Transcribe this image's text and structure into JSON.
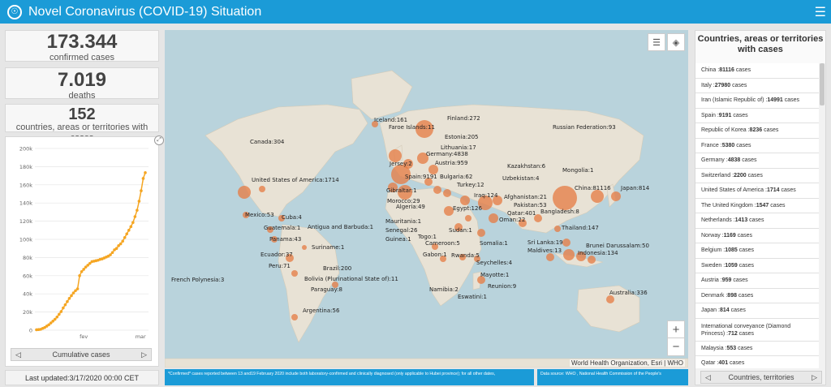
{
  "header": {
    "title": "Novel Coronavirus (COVID-19) Situation",
    "menu_icon": "hamburger-icon"
  },
  "stats": {
    "confirmed": {
      "value": "173.344",
      "label": "confirmed cases"
    },
    "deaths": {
      "value": "7.019",
      "label": "deaths"
    },
    "countries": {
      "value": "152",
      "label": "countries, areas or territories with cases"
    }
  },
  "chart_data": {
    "type": "area",
    "title": "",
    "xlabel": "",
    "ylabel": "",
    "x_ticks": [
      "fev",
      "mar"
    ],
    "y_ticks": [
      "0",
      "20k",
      "40k",
      "60k",
      "80k",
      "100k",
      "120k",
      "140k",
      "160k",
      "180k",
      "200k"
    ],
    "ylim": [
      0,
      200000
    ],
    "grid": true,
    "series": [
      {
        "values": [
          500,
          700,
          1000,
          2000,
          3000,
          4500,
          6000,
          8000,
          10000,
          12000,
          14500,
          17500,
          20500,
          24500,
          28000,
          31500,
          35000,
          38000,
          41000,
          43500,
          45500,
          60000,
          64500,
          67000,
          69500,
          71500,
          73500,
          75500,
          76000,
          76500,
          77000,
          78000,
          78500,
          79500,
          80500,
          81500,
          83000,
          85500,
          88500,
          90000,
          93000,
          95000,
          98000,
          102000,
          106000,
          110000,
          114000,
          118500,
          125000,
          132000,
          142000,
          153500,
          167000,
          173344
        ]
      }
    ],
    "nav_label": "Cumulative cases"
  },
  "updated": "Last updated:3/17/2020 00:00 CET",
  "map": {
    "labels": [
      {
        "t": "Iceland:161"
      },
      {
        "t": "Finland:272"
      },
      {
        "t": "Faroe Islands:11"
      },
      {
        "t": "Estonia:205"
      },
      {
        "t": "Russian Federation:93"
      },
      {
        "t": "Canada:304"
      },
      {
        "t": "Lithuania:17"
      },
      {
        "t": "Germany:4838"
      },
      {
        "t": "Jersey:2"
      },
      {
        "t": "Austria:959"
      },
      {
        "t": "Kazakhstan:6"
      },
      {
        "t": "Mongolia:1"
      },
      {
        "t": "United States of America:1714"
      },
      {
        "t": "Spain:9191"
      },
      {
        "t": "Bulgaria:62"
      },
      {
        "t": "Uzbekistan:4"
      },
      {
        "t": "Turkey:12"
      },
      {
        "t": "China:81116"
      },
      {
        "t": "Japan:814"
      },
      {
        "t": "Gibraltar:1"
      },
      {
        "t": "Iraq:124"
      },
      {
        "t": "Afghanistan:21"
      },
      {
        "t": "Morocco:29"
      },
      {
        "t": "Pakistan:53"
      },
      {
        "t": "Algeria:49"
      },
      {
        "t": "Egypt:126"
      },
      {
        "t": "Qatar:401"
      },
      {
        "t": "Bangladesh:8"
      },
      {
        "t": "Mexico:53"
      },
      {
        "t": "Cuba:4"
      },
      {
        "t": "Oman:22"
      },
      {
        "t": "Mauritania:1"
      },
      {
        "t": "Thailand:147"
      },
      {
        "t": "Guatemala:1"
      },
      {
        "t": "Antigua and Barbuda:1"
      },
      {
        "t": "Senegal:26"
      },
      {
        "t": "Sudan:1"
      },
      {
        "t": "Panama:43"
      },
      {
        "t": "Togo:1"
      },
      {
        "t": "Guinea:1"
      },
      {
        "t": "Suriname:1"
      },
      {
        "t": "Cameroon:5"
      },
      {
        "t": "Somalia:1"
      },
      {
        "t": "Sri Lanka:19"
      },
      {
        "t": "Maldives:13"
      },
      {
        "t": "Brunei Darussalam:50"
      },
      {
        "t": "Ecuador:37"
      },
      {
        "t": "Gabon:1"
      },
      {
        "t": "Rwanda:5"
      },
      {
        "t": "Indonesia:134"
      },
      {
        "t": "Peru:71"
      },
      {
        "t": "Brazil:200"
      },
      {
        "t": "Seychelles:4"
      },
      {
        "t": "Mayotte:1"
      },
      {
        "t": "French Polynesia:3"
      },
      {
        "t": "Bolivia (Plurinational State of):11"
      },
      {
        "t": "Namibia:2"
      },
      {
        "t": "Reunion:9"
      },
      {
        "t": "Paraguay:8"
      },
      {
        "t": "Eswatini:1"
      },
      {
        "t": "Australia:336"
      },
      {
        "t": "Argentina:56"
      }
    ],
    "attribution": "World Health Organization, Esri | WHO",
    "zoom_in": "+",
    "zoom_out": "−",
    "footnote": "*Confirmed* cases reported between 13 and19 February 2020 include both laboratory-confirmed and clinically diagnosed (only  applicable to Hubei province); for all other dates,",
    "source": "Data source: WHO , National Health Commission of the People's"
  },
  "right_panel": {
    "title": "Countries, areas or territories with cases",
    "suffix": "cases",
    "items": [
      {
        "name": "China",
        "count": "81116"
      },
      {
        "name": "Italy",
        "count": "27980"
      },
      {
        "name": "Iran (Islamic Republic of)",
        "count": "14991"
      },
      {
        "name": "Spain",
        "count": "9191"
      },
      {
        "name": "Republic of Korea",
        "count": "8236"
      },
      {
        "name": "France",
        "count": "5380"
      },
      {
        "name": "Germany",
        "count": "4838"
      },
      {
        "name": "Switzerland",
        "count": "2200"
      },
      {
        "name": "United States of America",
        "count": "1714"
      },
      {
        "name": "The United Kingdom",
        "count": "1547"
      },
      {
        "name": "Netherlands",
        "count": "1413"
      },
      {
        "name": "Norway",
        "count": "1169"
      },
      {
        "name": "Belgium",
        "count": "1085"
      },
      {
        "name": "Sweden",
        "count": "1059"
      },
      {
        "name": "Austria",
        "count": "959"
      },
      {
        "name": "Denmark",
        "count": "898"
      },
      {
        "name": "Japan",
        "count": "814"
      },
      {
        "name": "International conveyance (Diamond Princess)",
        "count": "712"
      },
      {
        "name": "Malaysia",
        "count": "553"
      },
      {
        "name": "Qatar",
        "count": "401"
      }
    ],
    "nav_label": "Countries, territories"
  }
}
